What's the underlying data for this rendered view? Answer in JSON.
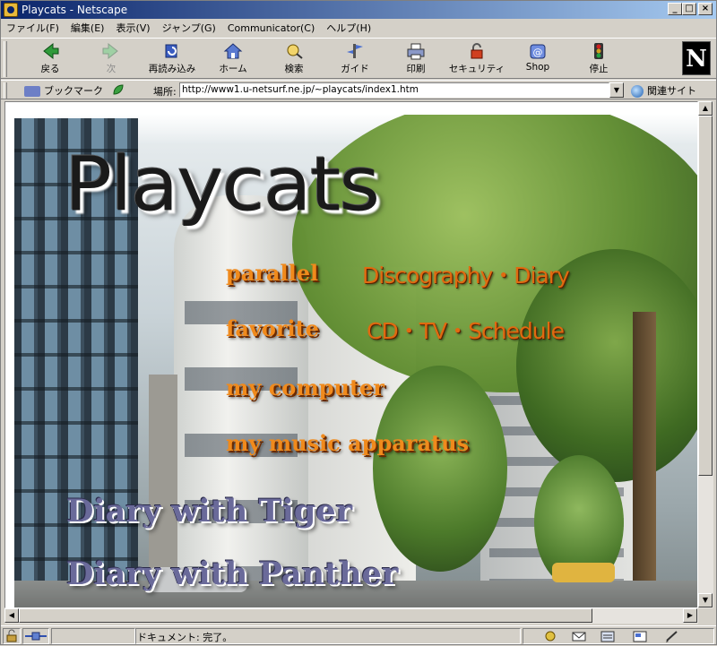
{
  "window": {
    "title": "Playcats - Netscape",
    "controls": {
      "minimize": "_",
      "maximize": "□",
      "close": "×"
    }
  },
  "menu": [
    "ファイル(F)",
    "編集(E)",
    "表示(V)",
    "ジャンプ(G)",
    "Communicator(C)",
    "ヘルプ(H)"
  ],
  "toolbar": {
    "back": "戻る",
    "forward": "次",
    "reload": "再読み込み",
    "home": "ホーム",
    "search": "検索",
    "guide": "ガイド",
    "print": "印刷",
    "security": "セキュリティ",
    "shop": "Shop",
    "stop": "停止",
    "logo": "N"
  },
  "location": {
    "bookmarks_label": "ブックマーク",
    "location_label": "場所:",
    "url": "http://www1.u-netsurf.ne.jp/~playcats/index1.htm",
    "related_label": "関連サイト"
  },
  "page": {
    "site_title": "Playcats",
    "links": [
      {
        "main": "parallel",
        "sub": "Discography・Diary"
      },
      {
        "main": "favorite",
        "sub": "CD・TV・Schedule"
      },
      {
        "main": "my computer",
        "sub": ""
      },
      {
        "main": "my music apparatus",
        "sub": ""
      }
    ],
    "diaries": [
      "Diary with Tiger",
      "Diary with Panther"
    ]
  },
  "status": {
    "text": "ドキュメント: 完了。"
  },
  "colors": {
    "title_bar": "#0a246a",
    "link_orange": "#f08a1c",
    "diary_purple": "#6a6a9a"
  }
}
